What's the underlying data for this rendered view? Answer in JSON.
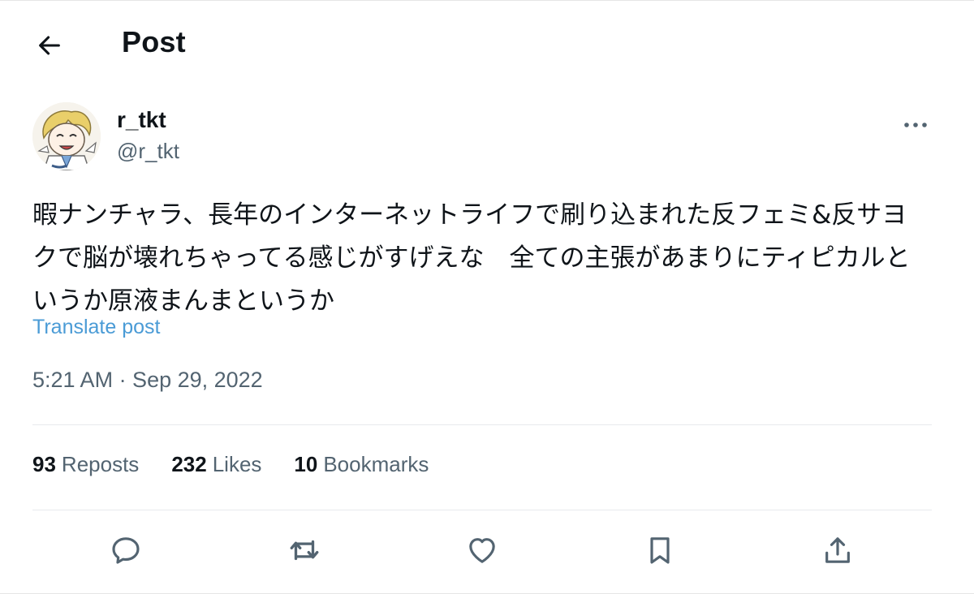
{
  "header": {
    "title": "Post",
    "back_icon": "arrow-left-icon"
  },
  "author": {
    "display_name": "r_tkt",
    "handle": "@r_tkt",
    "more_icon": "more-horizontal-icon"
  },
  "post": {
    "text_lines": [
      "暇ナンチャラ、長年のインターネットライフで刷り込まれた反フェミ&反サヨ",
      "クで脳が壊れちゃってる感じがすげえな　全ての主張があまりにティピカルと",
      "いうか原液まんまというか"
    ],
    "translate_label": "Translate post",
    "timestamp": "5:21 AM · Sep 29, 2022"
  },
  "stats": [
    {
      "count": "93",
      "label": "Reposts"
    },
    {
      "count": "232",
      "label": "Likes"
    },
    {
      "count": "10",
      "label": "Bookmarks"
    }
  ],
  "actions": [
    {
      "name": "reply",
      "icon": "reply-icon"
    },
    {
      "name": "repost",
      "icon": "repost-icon"
    },
    {
      "name": "like",
      "icon": "heart-icon"
    },
    {
      "name": "bookmark",
      "icon": "bookmark-icon"
    },
    {
      "name": "share",
      "icon": "share-icon"
    }
  ],
  "colors": {
    "text": "#0f1419",
    "secondary": "#536471",
    "link": "#4a9bd6",
    "divider": "#e8eaed"
  }
}
